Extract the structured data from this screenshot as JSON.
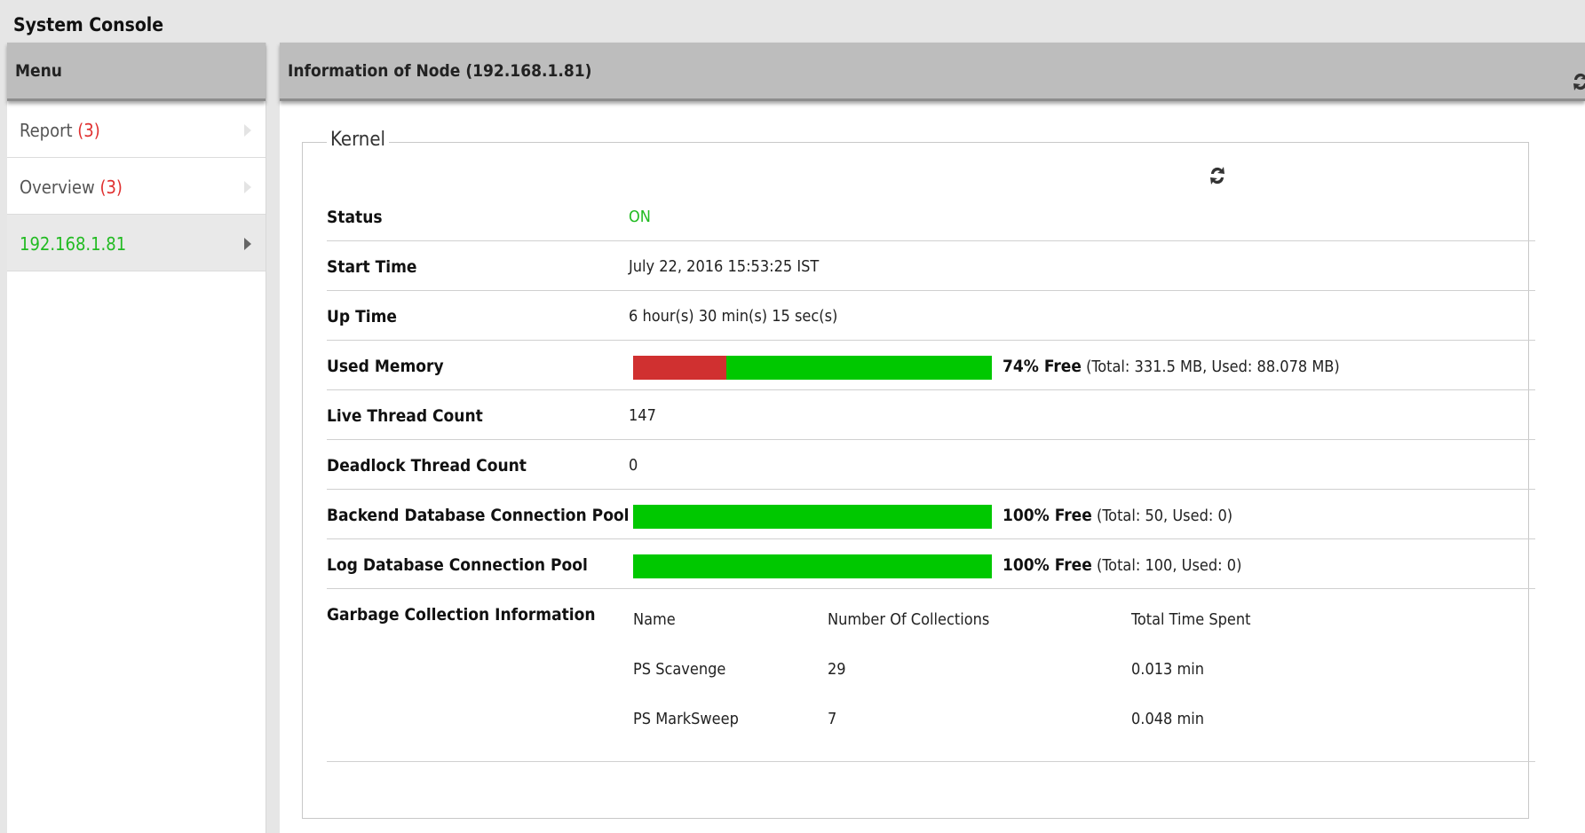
{
  "app": {
    "title": "System Console"
  },
  "menu": {
    "header": "Menu",
    "items": [
      {
        "label": "Report",
        "count": "(3)"
      },
      {
        "label": "Overview",
        "count": "(3)"
      },
      {
        "label": "192.168.1.81",
        "count": ""
      }
    ]
  },
  "main": {
    "header": "Information of Node (192.168.1.81)",
    "section_title": "Kernel",
    "status": {
      "label": "Status",
      "value": "ON",
      "color": "#22bb22"
    },
    "start_time": {
      "label": "Start Time",
      "value": "July 22, 2016 15:53:25 IST"
    },
    "up_time": {
      "label": "Up Time",
      "value": "6 hour(s) 30 min(s) 15 sec(s)"
    },
    "used_memory": {
      "label": "Used Memory",
      "free_percent": 74,
      "free_text": "74% Free",
      "detail": "(Total: 331.5 MB, Used: 88.078 MB)"
    },
    "live_threads": {
      "label": "Live Thread Count",
      "value": "147"
    },
    "deadlock_threads": {
      "label": "Deadlock Thread Count",
      "value": "0"
    },
    "backend_pool": {
      "label": "Backend Database Connection Pool",
      "free_percent": 100,
      "free_text": "100% Free",
      "detail": "(Total: 50, Used: 0)"
    },
    "log_pool": {
      "label": "Log Database Connection Pool",
      "free_percent": 100,
      "free_text": "100% Free",
      "detail": "(Total: 100, Used: 0)"
    },
    "gc": {
      "label": "Garbage Collection Information",
      "columns": [
        "Name",
        "Number Of Collections",
        "Total Time Spent"
      ],
      "rows": [
        [
          "PS Scavenge",
          "29",
          "0.013 min"
        ],
        [
          "PS MarkSweep",
          "7",
          "0.048 min"
        ]
      ]
    }
  },
  "colors": {
    "bar_free": "#00c800",
    "bar_used": "#d03030",
    "count": "#e03030",
    "active_item": "#22bb22"
  },
  "icons": {
    "refresh": "refresh-icon"
  }
}
